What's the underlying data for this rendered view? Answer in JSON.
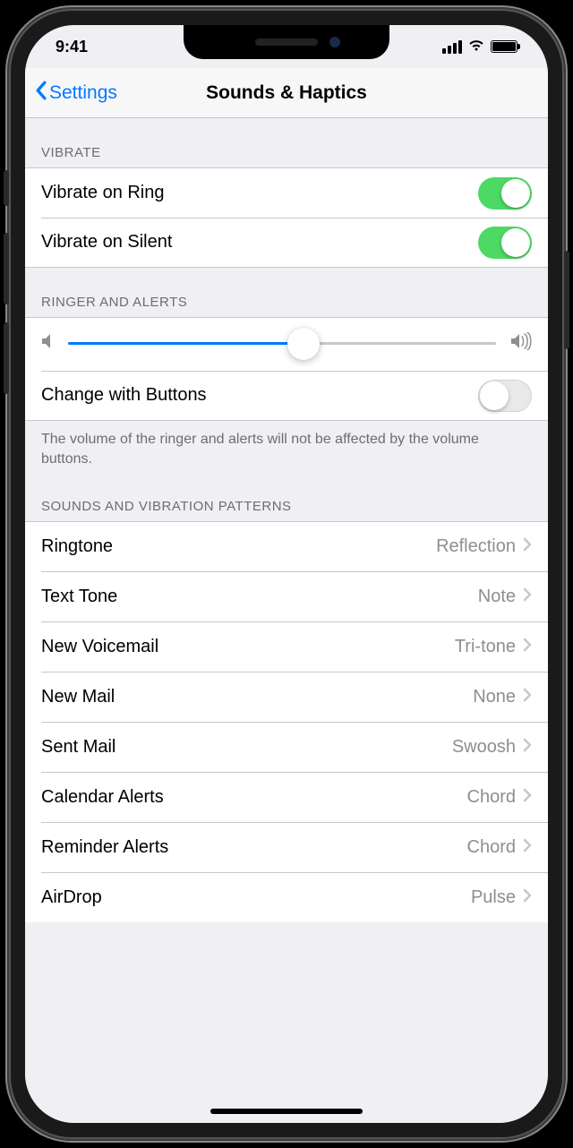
{
  "status": {
    "time": "9:41"
  },
  "nav": {
    "back": "Settings",
    "title": "Sounds & Haptics"
  },
  "vibrate": {
    "header": "VIBRATE",
    "ring_label": "Vibrate on Ring",
    "ring_on": true,
    "silent_label": "Vibrate on Silent",
    "silent_on": true
  },
  "ringer": {
    "header": "RINGER AND ALERTS",
    "volume_percent": 55,
    "change_label": "Change with Buttons",
    "change_on": false,
    "footer": "The volume of the ringer and alerts will not be affected by the volume buttons."
  },
  "patterns": {
    "header": "SOUNDS AND VIBRATION PATTERNS",
    "items": [
      {
        "label": "Ringtone",
        "value": "Reflection"
      },
      {
        "label": "Text Tone",
        "value": "Note"
      },
      {
        "label": "New Voicemail",
        "value": "Tri-tone"
      },
      {
        "label": "New Mail",
        "value": "None"
      },
      {
        "label": "Sent Mail",
        "value": "Swoosh"
      },
      {
        "label": "Calendar Alerts",
        "value": "Chord"
      },
      {
        "label": "Reminder Alerts",
        "value": "Chord"
      },
      {
        "label": "AirDrop",
        "value": "Pulse"
      }
    ]
  }
}
